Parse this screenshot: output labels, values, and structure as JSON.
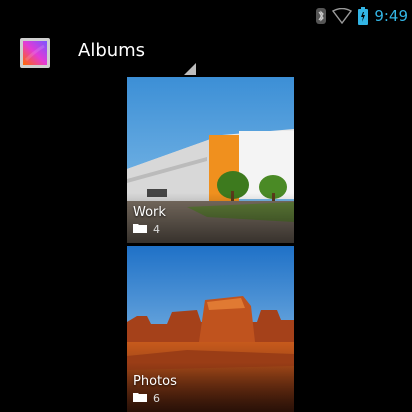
{
  "status_bar": {
    "time": "9:49",
    "icons": [
      "bluetooth-icon",
      "wifi-icon",
      "battery-icon"
    ],
    "clock_color": "#33b5e5"
  },
  "action_bar": {
    "title": "Albums",
    "app_icon": "gallery-icon"
  },
  "albums": [
    {
      "name": "Work",
      "count": "4",
      "icon": "folder-icon"
    },
    {
      "name": "Photos",
      "count": "6",
      "icon": "folder-icon"
    }
  ]
}
